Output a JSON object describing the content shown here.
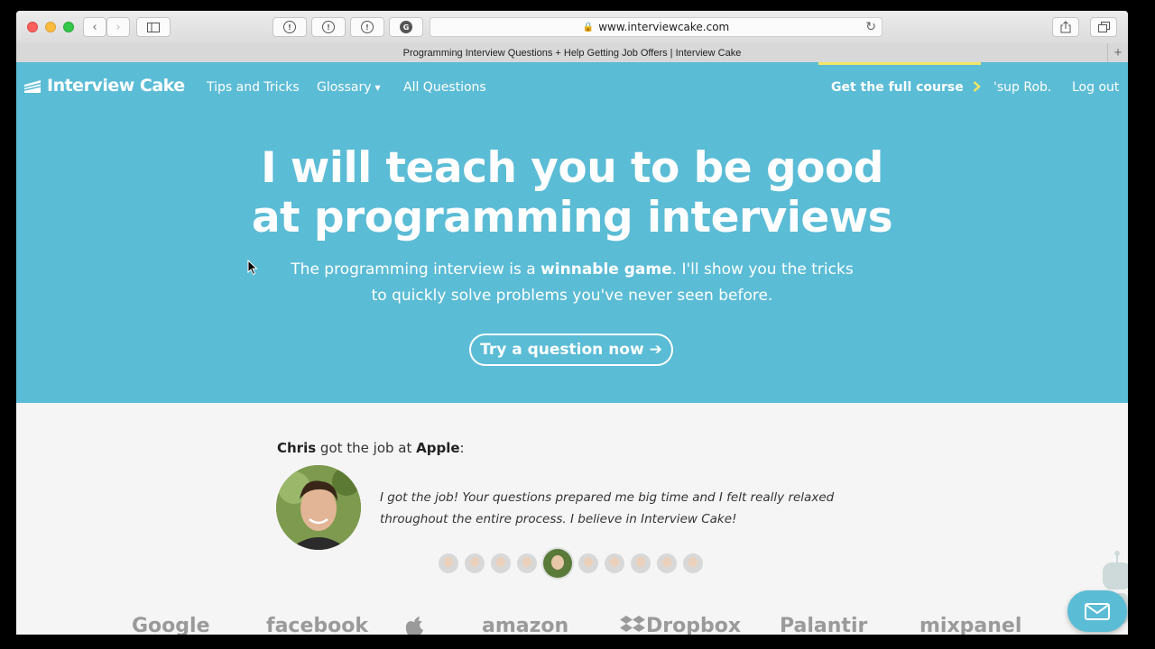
{
  "browser": {
    "url": "www.interviewcake.com",
    "tab_title": "Programming Interview Questions + Help Getting Job Offers | Interview Cake",
    "new_tab": "+"
  },
  "nav": {
    "brand": "Interview Cake",
    "links": [
      "Tips and Tricks",
      "Glossary",
      "All Questions"
    ],
    "full_course": "Get the full course",
    "greeting": "'sup Rob.",
    "logout": "Log out"
  },
  "hero": {
    "headline_line1": "I will teach you to be good",
    "headline_line2": "at programming interviews",
    "sub_before": "The programming interview is a ",
    "sub_bold": "winnable game",
    "sub_after": ". I'll show you the tricks",
    "sub_line2": "to quickly solve problems you've never seen before.",
    "cta": "Try a question now ➔"
  },
  "testimonial": {
    "name": "Chris",
    "middle": " got the job at ",
    "company": "Apple",
    "colon": ":",
    "quote_line1": "I got the job! Your questions prepared me big time and I felt really relaxed",
    "quote_line2": "throughout the entire process. I believe in Interview Cake!",
    "avatar_count": 10,
    "active_index": 4
  },
  "company_logos": [
    "Google",
    "facebook",
    "",
    "amazon",
    "Dropbox",
    "Palantir",
    "mixpanel"
  ],
  "colors": {
    "hero": "#5bbcd6",
    "accent_line": "#f5e663"
  }
}
